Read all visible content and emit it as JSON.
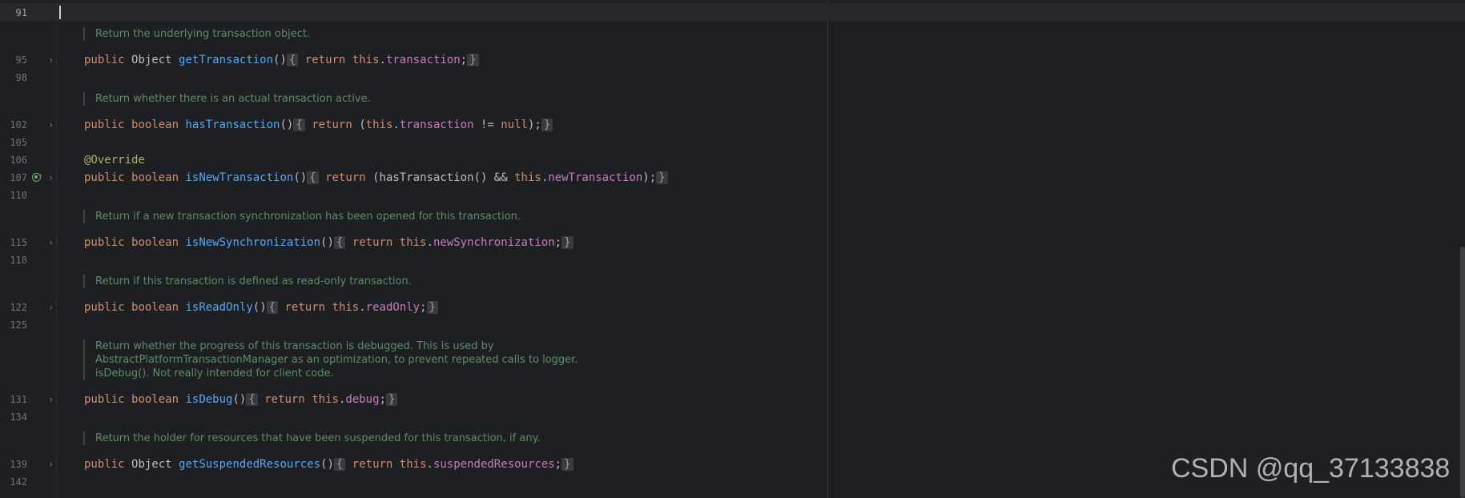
{
  "lines": {
    "l91": "91",
    "l95": "95",
    "l98": "98",
    "l102": "102",
    "l105": "105",
    "l106": "106",
    "l107": "107",
    "l110": "110",
    "l115": "115",
    "l118": "118",
    "l122": "122",
    "l125": "125",
    "l131": "131",
    "l134": "134",
    "l139": "139",
    "l142": "142"
  },
  "docs": {
    "d1": "Return the underlying transaction object.",
    "d2": "Return whether there is an actual transaction active.",
    "d3": "Return if a new transaction synchronization has been opened for this transaction.",
    "d4": "Return if this transaction is defined as read-only transaction.",
    "d5a": "Return whether the progress of this transaction is debugged. This is used by",
    "d5b": "AbstractPlatformTransactionManager as an optimization, to prevent repeated calls to logger.",
    "d5c": "isDebug(). Not really intended for client code.",
    "d6": "Return the holder for resources that have been suspended for this transaction, if any."
  },
  "code": {
    "kw_public": "public",
    "kw_boolean": "boolean",
    "kw_return": "return",
    "kw_this": "this",
    "kw_null": "null",
    "type_object": "Object",
    "annotation": "@Override",
    "m_getTransaction": "getTransaction",
    "m_hasTransaction": "hasTransaction",
    "m_isNewTransaction": "isNewTransaction",
    "m_isNewSynchronization": "isNewSynchronization",
    "m_isReadOnly": "isReadOnly",
    "m_isDebug": "isDebug",
    "m_getSuspendedResources": "getSuspendedResources",
    "f_transaction": "transaction",
    "f_newTransaction": "newTransaction",
    "f_newSynchronization": "newSynchronization",
    "f_readOnly": "readOnly",
    "f_debug": "debug",
    "f_suspendedResources": "suspendedResources",
    "call_hasTransaction": "hasTransaction"
  },
  "watermark": "CSDN @qq_37133838",
  "colors": {
    "background": "#1e1f22",
    "keyword": "#cf8e6d",
    "method": "#56a8f5",
    "field": "#c77dbb",
    "annotation": "#b3ae60",
    "doc": "#5f8c6a"
  }
}
